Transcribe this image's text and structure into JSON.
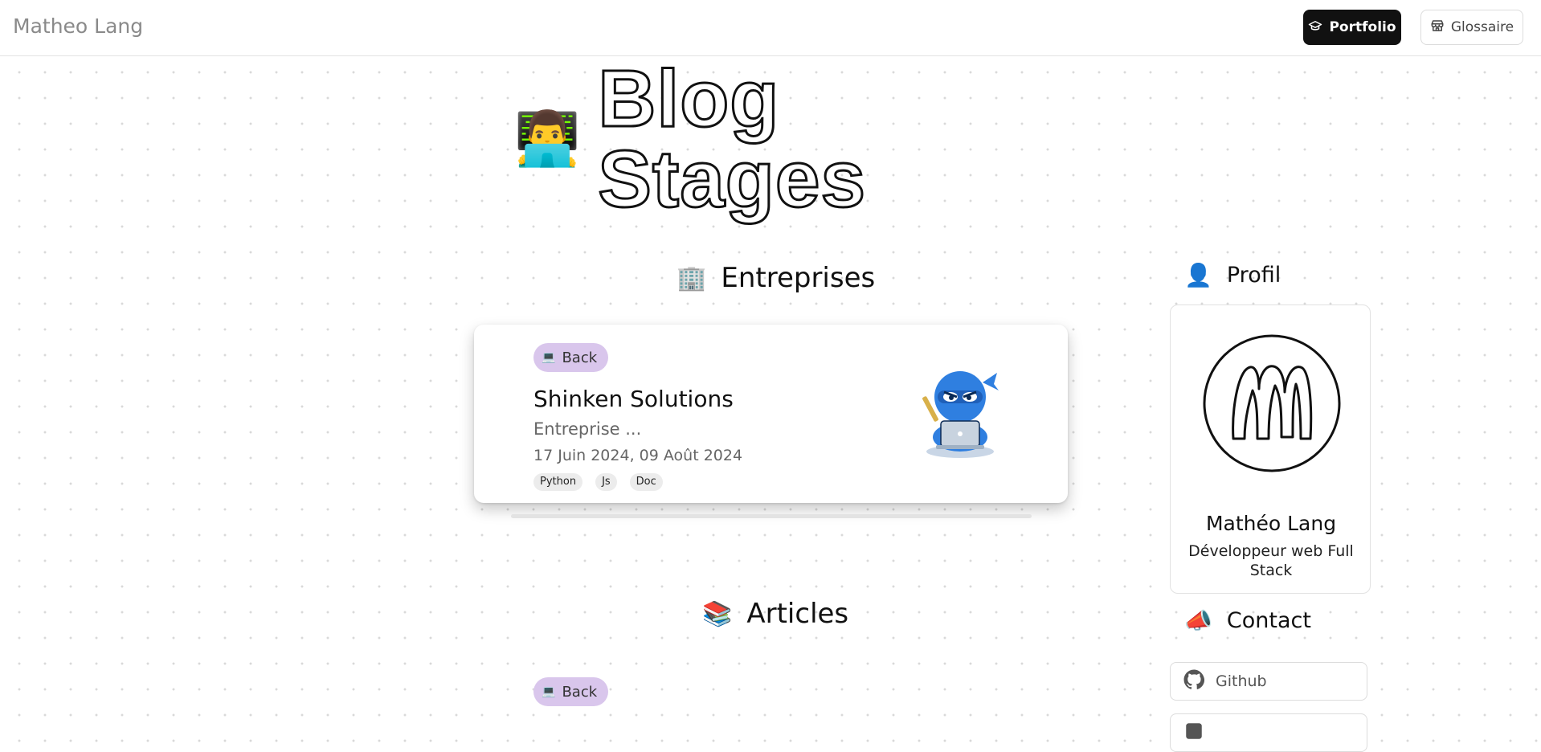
{
  "header": {
    "brand": "Matheo Lang",
    "nav": [
      {
        "label": "Portfolio",
        "icon": "graduation-cap-icon",
        "active": true
      },
      {
        "label": "Glossaire",
        "icon": "store-icon",
        "active": false
      }
    ]
  },
  "hero": {
    "emoji": "👨‍💻",
    "title": "Blog Stages"
  },
  "entreprises": {
    "heading_emoji": "🏢",
    "heading": "Entreprises",
    "cards": [
      {
        "badge_emoji": "💻",
        "badge": "Back",
        "title": "Shinken Solutions",
        "description": "Entreprise ...",
        "dates": "17 Juin 2024, 09 Août 2024",
        "tags": [
          "Python",
          "Js",
          "Doc"
        ],
        "image": "ninja-mascot-laptop"
      }
    ]
  },
  "articles": {
    "heading_emoji": "📚",
    "heading": "Articles",
    "first": {
      "badge_emoji": "💻",
      "badge": "Back"
    }
  },
  "sidebar": {
    "profil_emoji": "👤",
    "profil_heading": "Profil",
    "profile": {
      "logo": "letter-m-circle-logo",
      "name": "Mathéo Lang",
      "role": "Développeur web Full Stack"
    },
    "contact_emoji": "📣",
    "contact_heading": "Contact",
    "contacts": [
      {
        "label": "Github",
        "icon": "github-icon"
      }
    ]
  },
  "colors": {
    "badge_bg": "#d9c6ec",
    "nav_active_bg": "#111111",
    "mascot_blue": "#2f7fe0"
  }
}
